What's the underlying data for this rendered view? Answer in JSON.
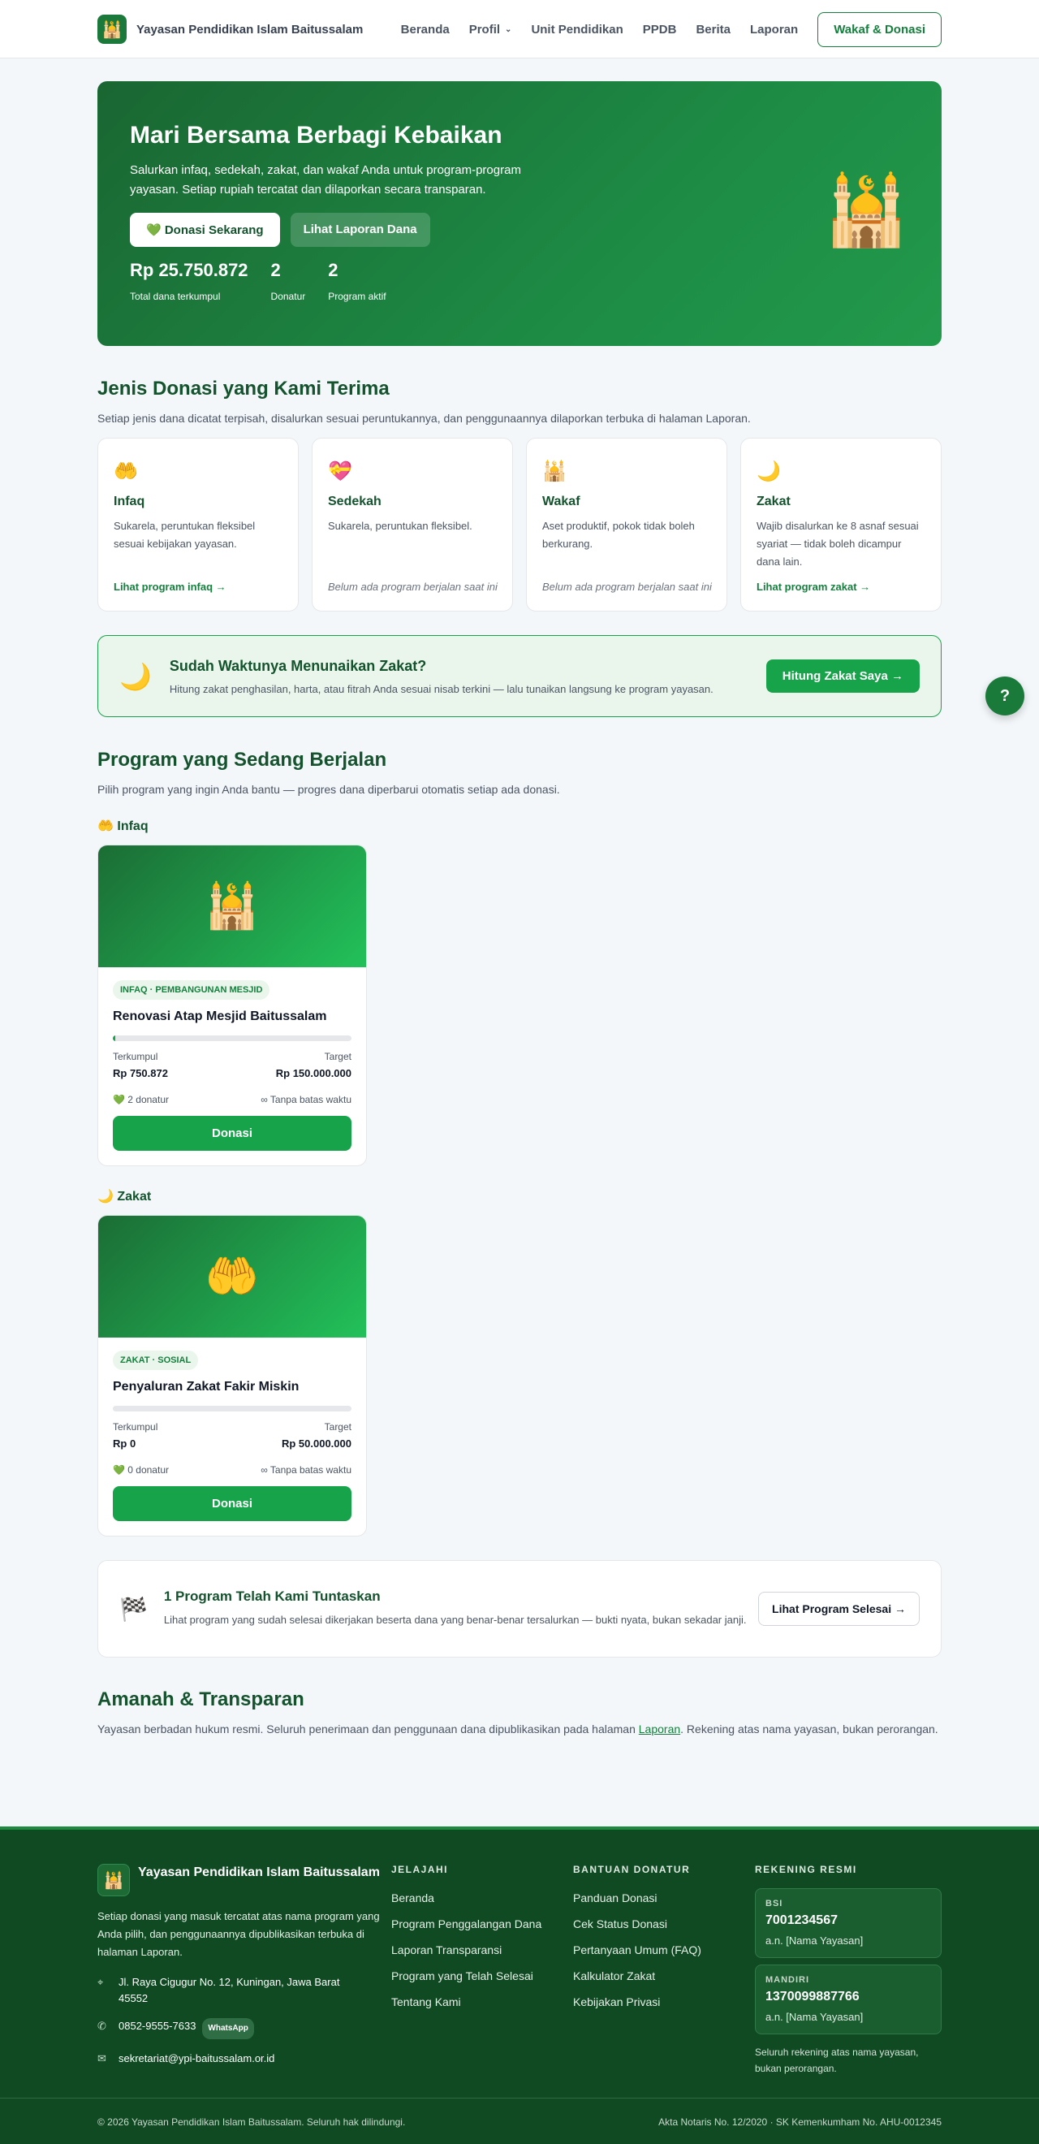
{
  "header": {
    "brand": "Yayasan Pendidikan Islam Baitussalam",
    "logo_icon": "🕌",
    "nav": [
      "Beranda",
      "Profil",
      "Unit Pendidikan",
      "PPDB",
      "Berita",
      "Laporan"
    ],
    "cta": "Wakaf & Donasi"
  },
  "hero": {
    "title": "Mari Bersama Berbagi Kebaikan",
    "text": "Salurkan infaq, sedekah, zakat, dan wakaf Anda untuk program-program yayasan. Setiap rupiah tercatat dan dilaporkan secara transparan.",
    "btn_donasi": "💚 Donasi Sekarang",
    "btn_laporan": "Lihat Laporan Dana",
    "stats": [
      {
        "value": "Rp 25.750.872",
        "label": "Total dana terkumpul"
      },
      {
        "value": "2",
        "label": "Donatur"
      },
      {
        "value": "2",
        "label": "Program aktif"
      }
    ],
    "icon": "🕌"
  },
  "jenis": {
    "title": "Jenis Donasi yang Kami Terima",
    "subtitle": "Setiap jenis dana dicatat terpisah, disalurkan sesuai peruntukannya, dan penggunaannya dilaporkan terbuka di halaman Laporan.",
    "cards": [
      {
        "icon": "🤲",
        "title": "Infaq",
        "desc": "Sukarela, peruntukan fleksibel sesuai kebijakan yayasan.",
        "foot": "Lihat program infaq →"
      },
      {
        "icon": "💝",
        "title": "Sedekah",
        "desc": "Sukarela, peruntukan fleksibel.",
        "foot": "Belum ada program berjalan saat ini"
      },
      {
        "icon": "🕌",
        "title": "Wakaf",
        "desc": "Aset produktif, pokok tidak boleh berkurang.",
        "foot": "Belum ada program berjalan saat ini"
      },
      {
        "icon": "🌙",
        "title": "Zakat",
        "desc": "Wajib disalurkan ke 8 asnaf sesuai syariat — tidak boleh dicampur dana lain.",
        "foot": "Lihat program zakat →"
      }
    ]
  },
  "zakat_banner": {
    "icon": "🌙",
    "title": "Sudah Waktunya Menunaikan Zakat?",
    "text": "Hitung zakat penghasilan, harta, atau fitrah Anda sesuai nisab terkini — lalu tunaikan langsung ke program yayasan.",
    "button": "Hitung Zakat Saya →"
  },
  "fab": "?",
  "programs": {
    "title": "Program yang Sedang Berjalan",
    "subtitle": "Pilih program yang ingin Anda bantu — progres dana diperbarui otomatis setiap ada donasi.",
    "groups": [
      {
        "category": "🤲 Infaq",
        "card": {
          "image_icon": "🕌",
          "tag": "INFAQ · PEMBANGUNAN MESJID",
          "title": "Renovasi Atap Mesjid Baitussalam",
          "progress": 0.005,
          "label_collected": "Terkumpul",
          "label_target": "Target",
          "collected": "Rp 750.872",
          "target": "Rp 150.000.000",
          "donors": "💚 2 donatur",
          "deadline": "∞ Tanpa batas waktu",
          "button": "Donasi"
        }
      },
      {
        "category": "🌙 Zakat",
        "card": {
          "image_icon": "🤲",
          "tag": "ZAKAT · SOSIAL",
          "title": "Penyaluran Zakat Fakir Miskin",
          "progress": 0,
          "label_collected": "Terkumpul",
          "label_target": "Target",
          "collected": "Rp 0",
          "target": "Rp 50.000.000",
          "donors": "💚 0 donatur",
          "deadline": "∞ Tanpa batas waktu",
          "button": "Donasi"
        }
      }
    ]
  },
  "done": {
    "icon": "🏁",
    "title": "1 Program Telah Kami Tuntaskan",
    "text": "Lihat program yang sudah selesai dikerjakan beserta dana yang benar-benar tersalurkan — bukti nyata, bukan sekadar janji.",
    "button": "Lihat Program Selesai →"
  },
  "amanah": {
    "title": "Amanah & Transparan",
    "text_before": "Yayasan berbadan hukum resmi. Seluruh penerimaan dan penggunaan dana dipublikasikan pada halaman ",
    "link": "Laporan",
    "text_after": ". Rekening atas nama yayasan, bukan perorangan."
  },
  "footer": {
    "brand": "Yayasan Pendidikan Islam Baitussalam",
    "desc": "Setiap donasi yang masuk tercatat atas nama program yang Anda pilih, dan penggunaannya dipublikasikan terbuka di halaman Laporan.",
    "address": "Jl. Raya Cigugur No. 12, Kuningan, Jawa Barat 45552",
    "phone": "0852-9555-7633",
    "whatsapp": "WhatsApp",
    "email": "sekretariat@ypi-baitussalam.or.id",
    "jelajahi_title": "JELAJAHI",
    "jelajahi": [
      "Beranda",
      "Program Penggalangan Dana",
      "Laporan Transparansi",
      "Program yang Telah Selesai",
      "Tentang Kami"
    ],
    "bantuan_title": "BANTUAN DONATUR",
    "bantuan": [
      "Panduan Donasi",
      "Cek Status Donasi",
      "Pertanyaan Umum (FAQ)",
      "Kalkulator Zakat",
      "Kebijakan Privasi"
    ],
    "rekening_title": "REKENING RESMI",
    "rekening": [
      {
        "bank": "BSI",
        "number": "7001234567",
        "name": "a.n. [Nama Yayasan]"
      },
      {
        "bank": "MANDIRI",
        "number": "1370099887766",
        "name": "a.n. [Nama Yayasan]"
      }
    ],
    "rekening_note": "Seluruh rekening atas nama yayasan, bukan perorangan.",
    "copyright": "© 2026 Yayasan Pendidikan Islam Baitussalam. Seluruh hak dilindungi.",
    "legal": "Akta Notaris No. 12/2020 · SK Kemenkumham No. AHU-0012345"
  }
}
